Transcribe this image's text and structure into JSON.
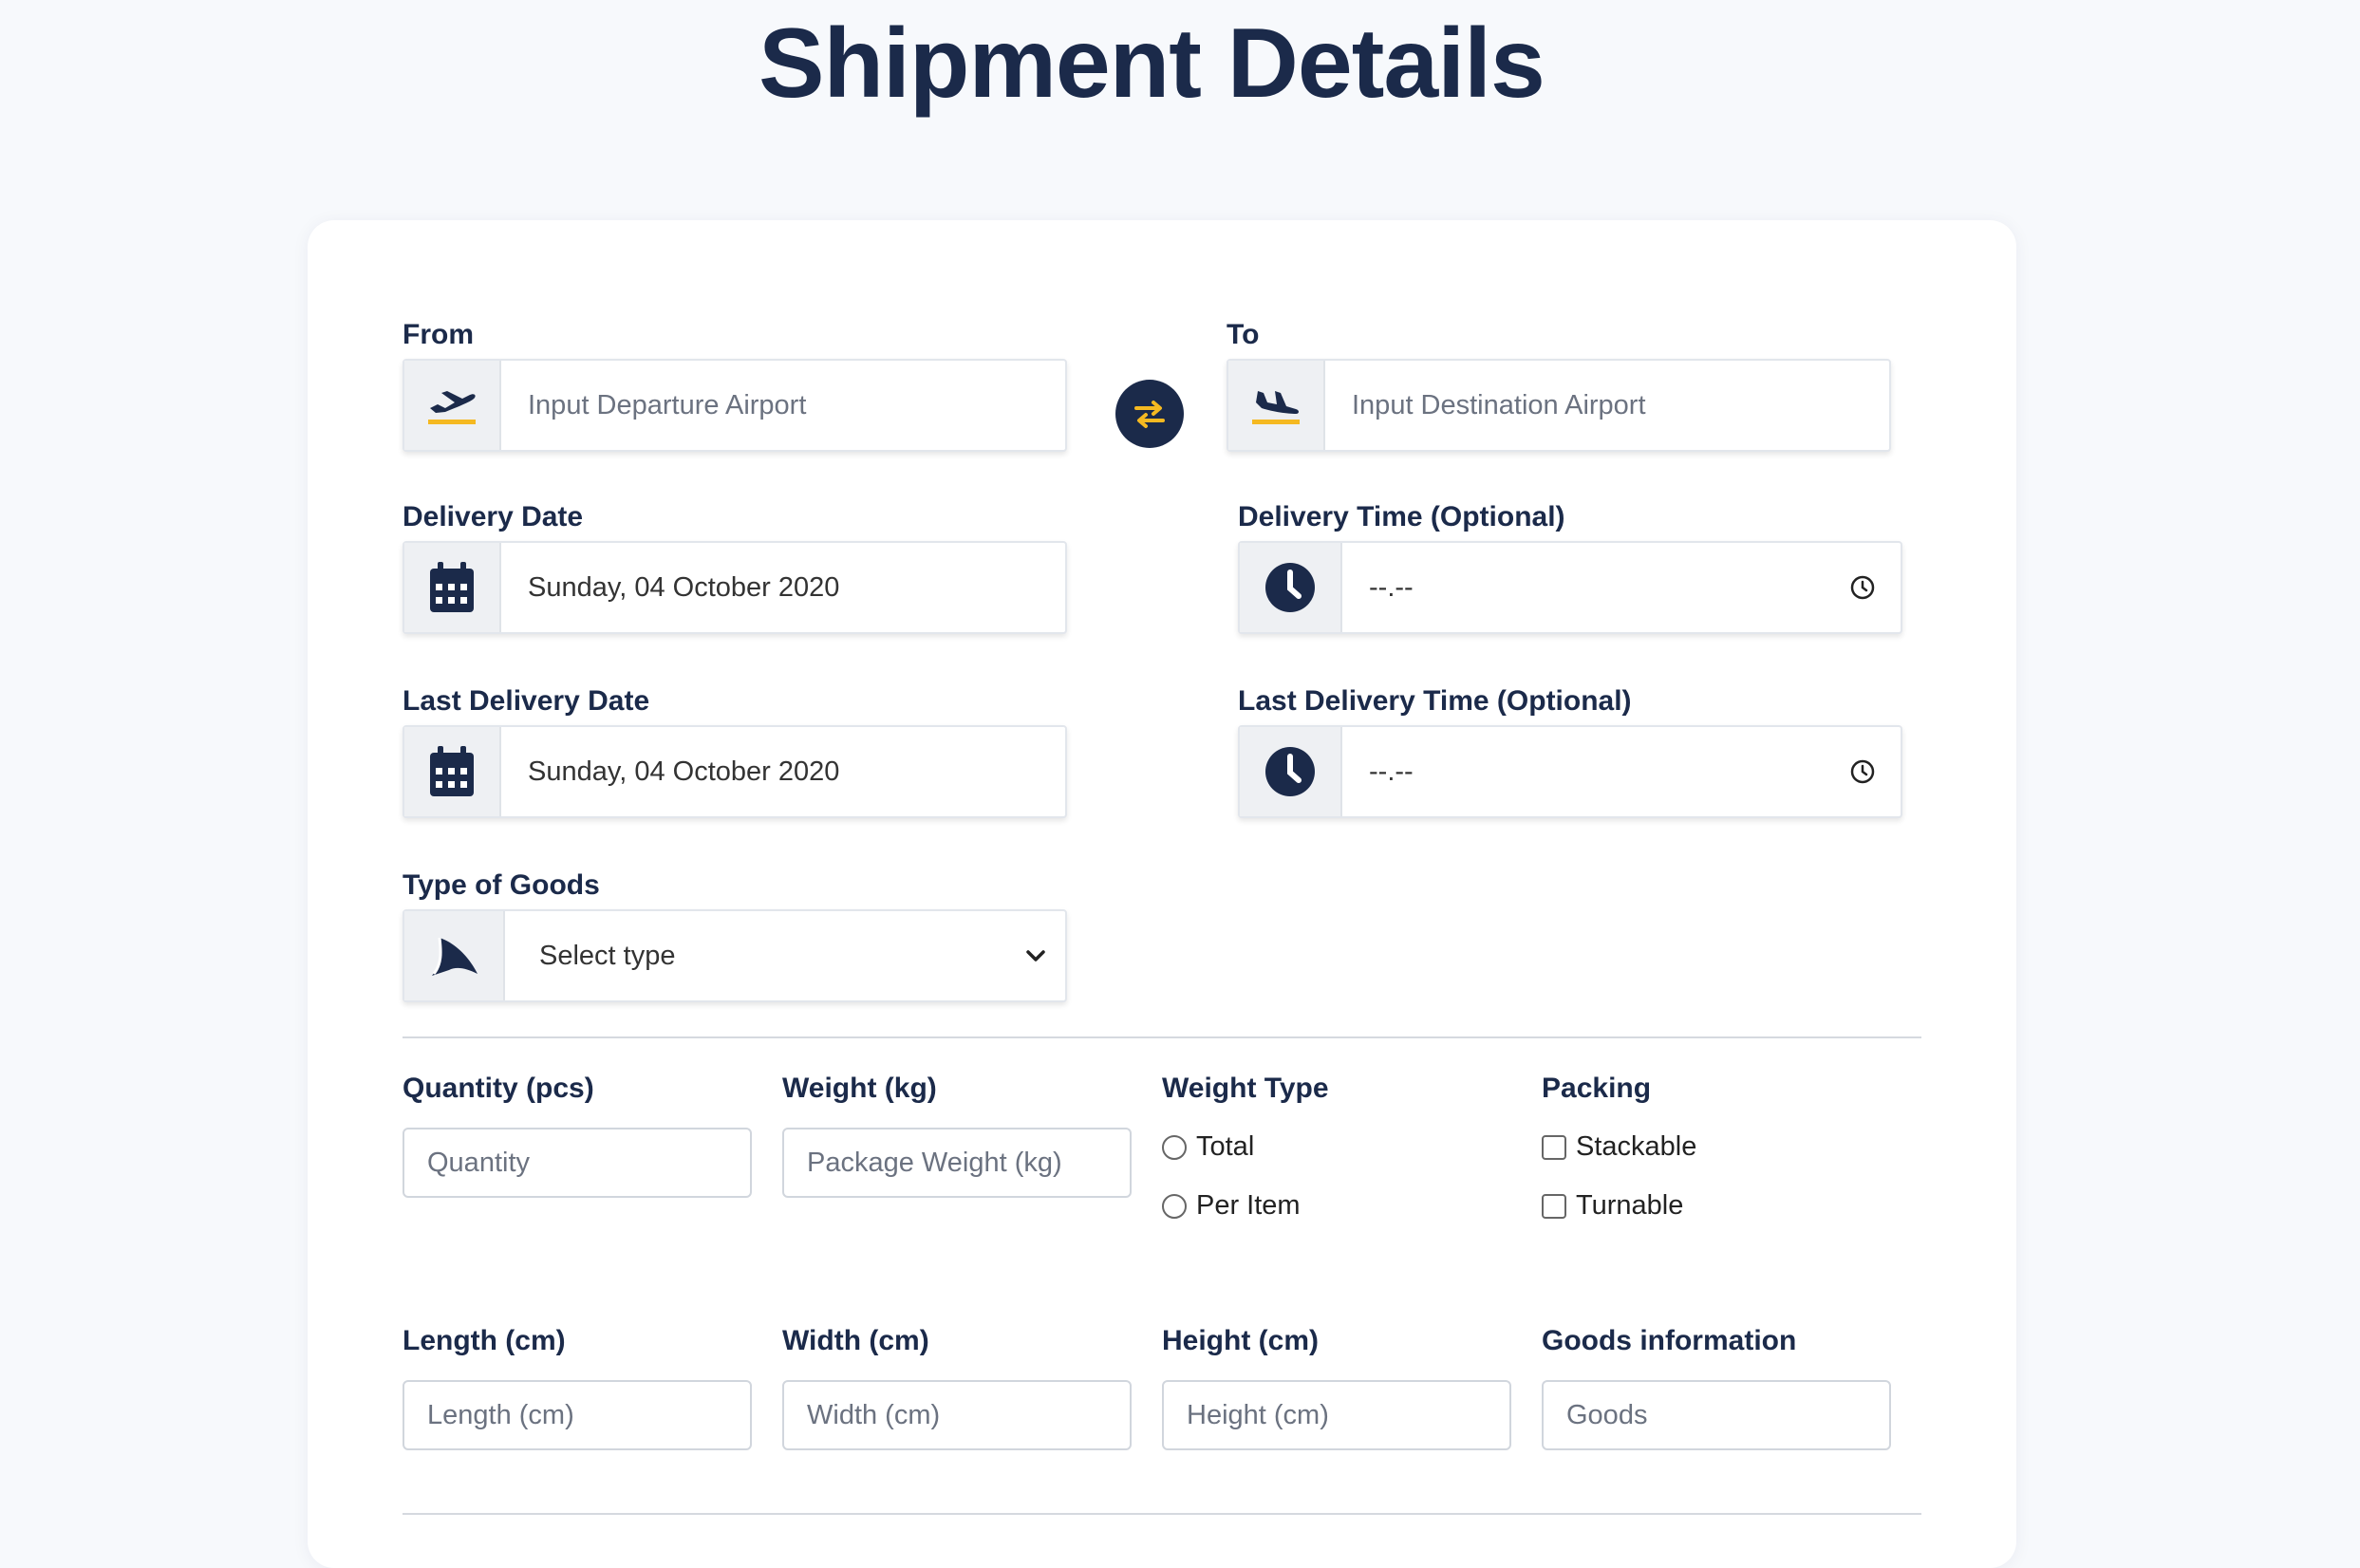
{
  "page": {
    "title": "Shipment Details"
  },
  "route": {
    "from_label": "From",
    "from_placeholder": "Input Departure Airport",
    "to_label": "To",
    "to_placeholder": "Input Destination Airport"
  },
  "delivery": {
    "date_label": "Delivery Date",
    "date_value": "Sunday, 04 October 2020",
    "time_label": "Delivery Time (Optional)",
    "time_value": "--.--",
    "last_date_label": "Last Delivery Date",
    "last_date_value": "Sunday, 04 October 2020",
    "last_time_label": "Last Delivery Time (Optional)",
    "last_time_value": "--.--"
  },
  "goods": {
    "type_label": "Type of Goods",
    "type_value": "Select type"
  },
  "details": {
    "quantity_label": "Quantity (pcs)",
    "quantity_placeholder": "Quantity",
    "weight_label": "Weight (kg)",
    "weight_placeholder": "Package Weight (kg)",
    "weight_type_label": "Weight Type",
    "weight_type_options": [
      "Total",
      "Per Item"
    ],
    "packing_label": "Packing",
    "packing_options": [
      "Stackable",
      "Turnable"
    ],
    "length_label": "Length (cm)",
    "length_placeholder": "Length (cm)",
    "width_label": "Width (cm)",
    "width_placeholder": "Width (cm)",
    "height_label": "Height (cm)",
    "height_placeholder": "Height (cm)",
    "goods_info_label": "Goods information",
    "goods_info_placeholder": "Goods"
  },
  "icons": {
    "from": "plane-departure-icon",
    "to": "plane-arrival-icon",
    "swap": "swap-arrows-icon",
    "date": "calendar-icon",
    "time": "clock-icon",
    "goods": "shark-fin-icon",
    "select": "chevron-down-icon"
  },
  "colors": {
    "primary": "#1b2a4a",
    "accent": "#f5b921",
    "background": "#f7f9fc"
  }
}
